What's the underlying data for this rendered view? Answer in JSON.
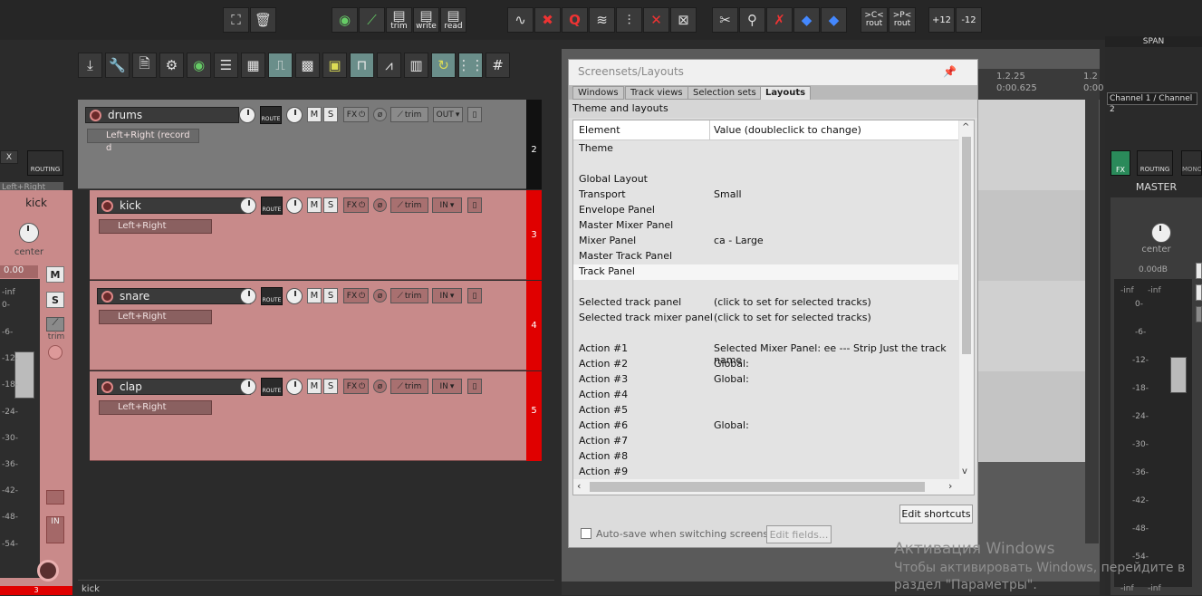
{
  "top_toolbar": {
    "buttons": [
      {
        "name": "fullscreen-button",
        "icon": "⛶"
      },
      {
        "name": "trash-button",
        "icon": "🗑"
      },
      {
        "name": "env-view-button",
        "icon": "👁"
      },
      {
        "name": "env-edit-button",
        "icon": "✎"
      },
      {
        "name": "trim-button",
        "label": "trim"
      },
      {
        "name": "write-button",
        "label": "write"
      },
      {
        "name": "read-button",
        "label": "read"
      }
    ],
    "route_in_label": ">C<",
    "route_in_sub": "rout",
    "route_out_label": ">P<",
    "route_out_sub": "rout",
    "plus12": "+12",
    "minus12": "-12",
    "span_label": "SPAN"
  },
  "left_strip": {
    "io_label": "Left+Right",
    "routing_label": "ROUTING",
    "track_name": "kick",
    "pan_label": "center",
    "volume_readout": "0.00",
    "mute": "M",
    "solo": "S",
    "trim_label": "trim",
    "input_label": "IN",
    "meter_scale": [
      "-inf",
      "0-",
      "-6-",
      "-12-",
      "-18-",
      "-24-",
      "-30-",
      "-36-",
      "-42-",
      "-48-",
      "-54-"
    ],
    "track_number": "3",
    "fx_label": "X"
  },
  "tracks": [
    {
      "name": "drums",
      "io": "Left+Right (record d",
      "num": "2",
      "mode": "OUT"
    },
    {
      "name": "kick",
      "io": "Left+Right",
      "num": "3",
      "mode": "IN"
    },
    {
      "name": "snare",
      "io": "Left+Right",
      "num": "4",
      "mode": "IN"
    },
    {
      "name": "clap",
      "io": "Left+Right",
      "num": "5",
      "mode": "IN"
    }
  ],
  "track_controls": {
    "mute": "M",
    "solo": "S",
    "fx": "FX",
    "trim": "trim",
    "route": "ROUTE"
  },
  "bottom_status": "kick",
  "ruler": {
    "t1": "1.2.25",
    "t1_sub": "0:00.625",
    "t2": "1.2",
    "t2_sub": "0:00"
  },
  "dialog": {
    "title": "Screensets/Layouts",
    "tabs": [
      "Windows",
      "Track views",
      "Selection sets",
      "Layouts"
    ],
    "active_tab": "Layouts",
    "section": "Theme and layouts",
    "col_element": "Element",
    "col_value": "Value (doubleclick to change)",
    "rows": [
      {
        "el": "Theme",
        "val": ""
      },
      {
        "el": "",
        "val": ""
      },
      {
        "el": "Global Layout",
        "val": ""
      },
      {
        "el": "Transport",
        "val": "Small"
      },
      {
        "el": "Envelope Panel",
        "val": ""
      },
      {
        "el": "Master Mixer Panel",
        "val": ""
      },
      {
        "el": "Mixer Panel",
        "val": "ca - Large"
      },
      {
        "el": "Master Track Panel",
        "val": ""
      },
      {
        "el": "Track Panel",
        "val": ""
      },
      {
        "el": "",
        "val": ""
      },
      {
        "el": "Selected track panel",
        "val": "(click to set for selected tracks)"
      },
      {
        "el": "Selected track mixer panel",
        "val": "(click to set for selected tracks)"
      },
      {
        "el": "",
        "val": ""
      },
      {
        "el": "Action #1",
        "val": "Selected Mixer Panel: ee --- Strip Just the track name"
      },
      {
        "el": "Action #2",
        "val": "Global:"
      },
      {
        "el": "Action #3",
        "val": "Global:"
      },
      {
        "el": "Action #4",
        "val": ""
      },
      {
        "el": "Action #5",
        "val": ""
      },
      {
        "el": "Action #6",
        "val": "Global:"
      },
      {
        "el": "Action #7",
        "val": ""
      },
      {
        "el": "Action #8",
        "val": ""
      },
      {
        "el": "Action #9",
        "val": ""
      }
    ],
    "edit_shortcuts": "Edit shortcuts",
    "autosave_label": "Auto-save when switching screensets",
    "edit_fields": "Edit fields..."
  },
  "master": {
    "channel_label": "Channel 1 / Channel 2",
    "fx_label": "FX",
    "routing_label": "ROUTING",
    "mono_label": "MONO",
    "name": "MASTER",
    "pan_label": "center",
    "volume_readout": "0.00dB",
    "peak_l": "-inf",
    "peak_r": "-inf",
    "scale": [
      "0-",
      "-6-",
      "-12-",
      "-18-",
      "-24-",
      "-30-",
      "-36-",
      "-42-",
      "-48-",
      "-54-"
    ],
    "bottom_l": "-inf",
    "bottom_r": "-inf"
  },
  "watermark": {
    "line1": "Активация Windows",
    "line2": "Чтобы активировать Windows, перейдите в",
    "line3": "раздел \"Параметры\"."
  }
}
